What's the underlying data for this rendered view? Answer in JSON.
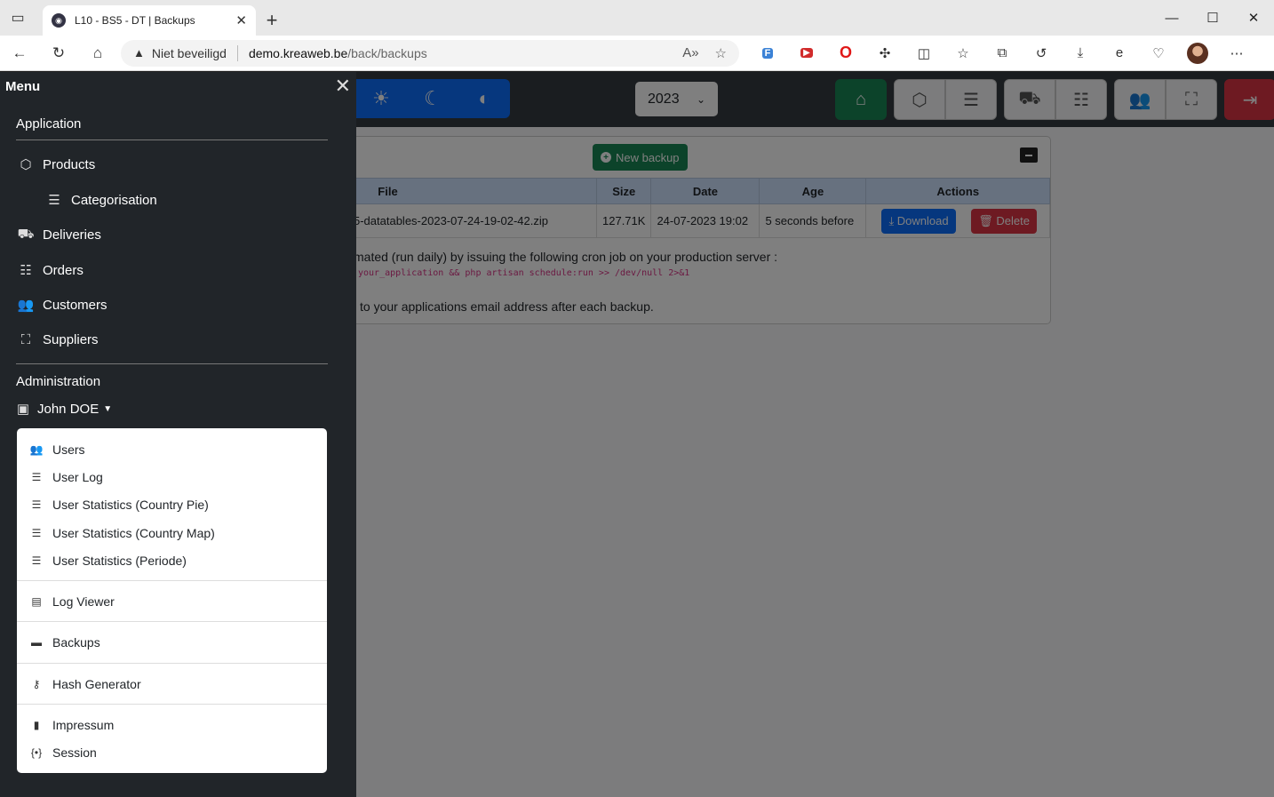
{
  "browser": {
    "tab_title": "L10 - BS5 - DT | Backups",
    "security_label": "Niet beveiligd",
    "url_host": "demo.kreaweb.be",
    "url_path": "/back/backups"
  },
  "topnav": {
    "year": "2023"
  },
  "backups": {
    "new_backup_label": "New backup",
    "columns": [
      "File",
      "Size",
      "Date",
      "Age",
      "Actions"
    ],
    "rows": [
      {
        "file": "5-datatables-2023-07-24-19-02-42.zip",
        "size": "127.71K",
        "date": "24-07-2023 19:02",
        "age": "5 seconds before"
      }
    ],
    "download_label": "Download",
    "delete_label": "Delete",
    "note1": "mated (run daily) by issuing the following cron job on your production server :",
    "code": "your_application && php artisan schedule:run >> /dev/null 2>&1",
    "note2": "l to your applications email address after each backup."
  },
  "menu": {
    "title": "Menu",
    "application_title": "Application",
    "products": "Products",
    "categorisation": "Categorisation",
    "deliveries": "Deliveries",
    "orders": "Orders",
    "customers": "Customers",
    "suppliers": "Suppliers",
    "administration_title": "Administration",
    "user_name": "John DOE",
    "dropdown": {
      "users": "Users",
      "user_log": "User Log",
      "stats_country_pie": "User Statistics (Country Pie)",
      "stats_country_map": "User Statistics (Country Map)",
      "stats_periode": "User Statistics (Periode)",
      "log_viewer": "Log Viewer",
      "backups": "Backups",
      "hash_generator": "Hash Generator",
      "impressum": "Impressum",
      "session": "Session"
    }
  }
}
